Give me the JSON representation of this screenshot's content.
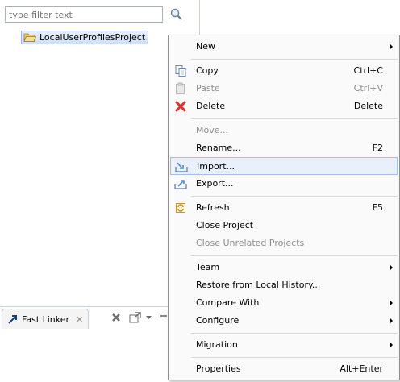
{
  "explorer": {
    "filter_placeholder": "type filter text",
    "project_label": "LocalUserProfilesProject"
  },
  "bottom_panel": {
    "tab_label": "Fast Linker"
  },
  "context_menu": {
    "items": [
      {
        "label": "New",
        "accelerator": "",
        "submenu": true,
        "enabled": true,
        "icon": ""
      },
      {
        "label": "Copy",
        "accelerator": "Ctrl+C",
        "submenu": false,
        "enabled": true,
        "icon": "copy-icon"
      },
      {
        "label": "Paste",
        "accelerator": "Ctrl+V",
        "submenu": false,
        "enabled": false,
        "icon": "paste-icon"
      },
      {
        "label": "Delete",
        "accelerator": "Delete",
        "submenu": false,
        "enabled": true,
        "icon": "delete-icon"
      },
      {
        "label": "Move...",
        "accelerator": "",
        "submenu": false,
        "enabled": false,
        "icon": ""
      },
      {
        "label": "Rename...",
        "accelerator": "F2",
        "submenu": false,
        "enabled": true,
        "icon": ""
      },
      {
        "label": "Import...",
        "accelerator": "",
        "submenu": false,
        "enabled": true,
        "icon": "import-icon",
        "highlighted": true
      },
      {
        "label": "Export...",
        "accelerator": "",
        "submenu": false,
        "enabled": true,
        "icon": "export-icon"
      },
      {
        "label": "Refresh",
        "accelerator": "F5",
        "submenu": false,
        "enabled": true,
        "icon": "refresh-icon"
      },
      {
        "label": "Close Project",
        "accelerator": "",
        "submenu": false,
        "enabled": true,
        "icon": ""
      },
      {
        "label": "Close Unrelated Projects",
        "accelerator": "",
        "submenu": false,
        "enabled": false,
        "icon": ""
      },
      {
        "label": "Team",
        "accelerator": "",
        "submenu": true,
        "enabled": true,
        "icon": ""
      },
      {
        "label": "Restore from Local History...",
        "accelerator": "",
        "submenu": false,
        "enabled": true,
        "icon": ""
      },
      {
        "label": "Compare With",
        "accelerator": "",
        "submenu": true,
        "enabled": true,
        "icon": ""
      },
      {
        "label": "Configure",
        "accelerator": "",
        "submenu": true,
        "enabled": true,
        "icon": ""
      },
      {
        "label": "Migration",
        "accelerator": "",
        "submenu": true,
        "enabled": true,
        "icon": ""
      },
      {
        "label": "Properties",
        "accelerator": "Alt+Enter",
        "submenu": false,
        "enabled": true,
        "icon": ""
      }
    ]
  },
  "colors": {
    "highlight_bg": "#e8f0fb",
    "highlight_border": "#a4bfe2",
    "disabled_text": "#8d8d8d",
    "delete_red": "#d9342b"
  }
}
